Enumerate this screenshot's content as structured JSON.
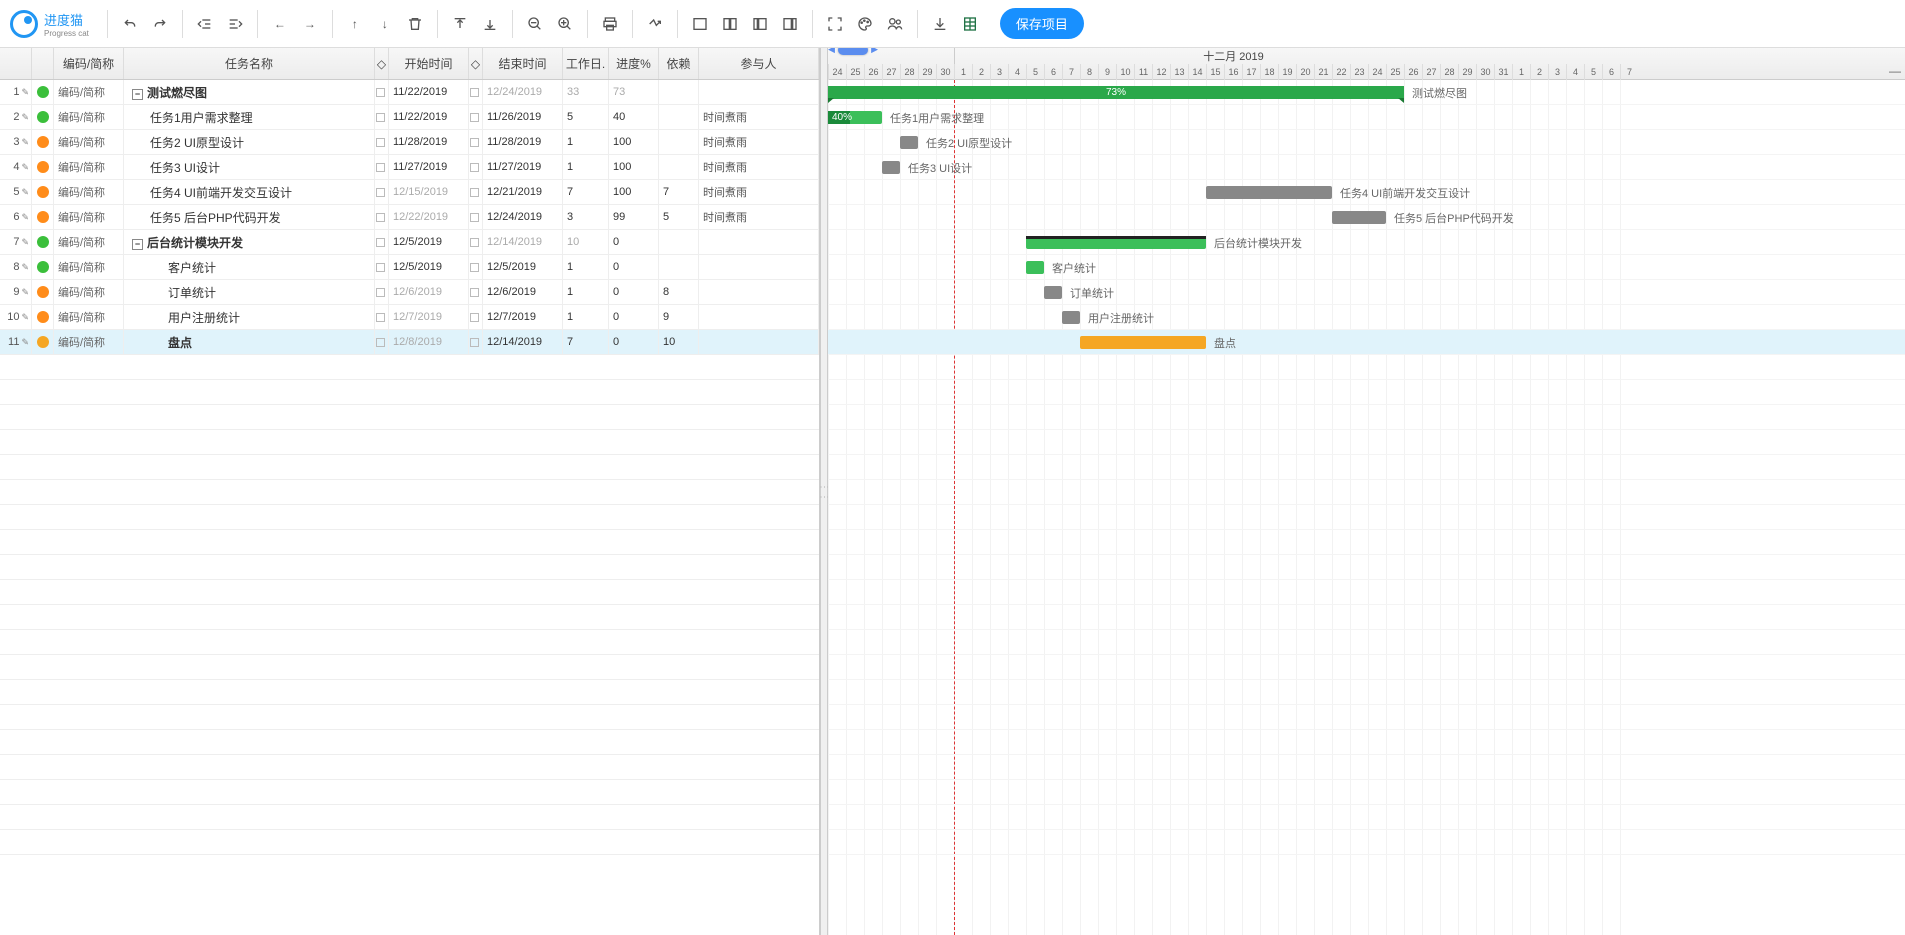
{
  "brand": {
    "name": "进度猫",
    "sub": "Progress cat"
  },
  "toolbar": {
    "save": "保存项目"
  },
  "columns": {
    "code": "编码/简称",
    "name": "任务名称",
    "start": "开始时间",
    "end": "结束时间",
    "days": "工作日.",
    "progress": "进度%",
    "dep": "依赖",
    "assign": "参与人"
  },
  "timeline": {
    "month": "十二月 2019",
    "days": [
      24,
      25,
      26,
      27,
      28,
      29,
      30,
      1,
      2,
      3,
      4,
      5,
      6,
      7,
      8,
      9,
      10,
      11,
      12,
      13,
      14,
      15,
      16,
      17,
      18,
      19,
      20,
      21,
      22,
      23,
      24,
      25,
      26,
      27,
      28,
      29,
      30,
      31,
      1,
      2,
      3,
      4,
      5,
      6,
      7
    ],
    "todayIndex": 7,
    "dayWidth": 18
  },
  "rows": [
    {
      "n": 1,
      "status": "green",
      "code": "编码/简称",
      "name": "测试燃尽图",
      "indent": 0,
      "group": true,
      "start": "11/22/2019",
      "end": "12/24/2019",
      "endDim": true,
      "days": "33",
      "daysDim": true,
      "prog": "73",
      "progDim": true,
      "dep": "",
      "assign": "",
      "barStart": 0,
      "barLen": 32,
      "barType": "group",
      "pct": "73%"
    },
    {
      "n": 2,
      "status": "green",
      "code": "编码/简称",
      "name": "任务1用户需求整理",
      "indent": 1,
      "start": "11/22/2019",
      "end": "11/26/2019",
      "days": "5",
      "prog": "40",
      "dep": "",
      "assign": "时间煮雨",
      "barStart": 0,
      "barLen": 3,
      "barType": "task",
      "pct": "40%",
      "progW": 40
    },
    {
      "n": 3,
      "status": "orange",
      "code": "编码/简称",
      "name": "任务2 UI原型设计",
      "indent": 1,
      "start": "11/28/2019",
      "end": "11/28/2019",
      "days": "1",
      "prog": "100",
      "dep": "",
      "assign": "时间煮雨",
      "barStart": 4,
      "barLen": 1,
      "barType": "done"
    },
    {
      "n": 4,
      "status": "orange",
      "code": "编码/简称",
      "name": "任务3 UI设计",
      "indent": 1,
      "start": "11/27/2019",
      "end": "11/27/2019",
      "days": "1",
      "prog": "100",
      "dep": "",
      "assign": "时间煮雨",
      "barStart": 3,
      "barLen": 1,
      "barType": "done"
    },
    {
      "n": 5,
      "status": "orange",
      "code": "编码/简称",
      "name": "任务4 UI前端开发交互设计",
      "indent": 1,
      "start": "12/15/2019",
      "startDim": true,
      "end": "12/21/2019",
      "days": "7",
      "prog": "100",
      "dep": "7",
      "assign": "时间煮雨",
      "barStart": 21,
      "barLen": 7,
      "barType": "grey"
    },
    {
      "n": 6,
      "status": "orange",
      "code": "编码/简称",
      "name": "任务5 后台PHP代码开发",
      "indent": 1,
      "start": "12/22/2019",
      "startDim": true,
      "end": "12/24/2019",
      "days": "3",
      "prog": "99",
      "dep": "5",
      "assign": "时间煮雨",
      "barStart": 28,
      "barLen": 3,
      "barType": "grey"
    },
    {
      "n": 7,
      "status": "green",
      "code": "编码/简称",
      "name": "后台统计模块开发",
      "indent": 0,
      "group": true,
      "start": "12/5/2019",
      "end": "12/14/2019",
      "endDim": true,
      "days": "10",
      "daysDim": true,
      "prog": "0",
      "dep": "",
      "assign": "",
      "barStart": 11,
      "barLen": 10,
      "barType": "group2"
    },
    {
      "n": 8,
      "status": "green",
      "code": "编码/简称",
      "name": "客户统计",
      "indent": 2,
      "start": "12/5/2019",
      "end": "12/5/2019",
      "days": "1",
      "prog": "0",
      "dep": "",
      "assign": "",
      "barStart": 11,
      "barLen": 1,
      "barType": "task"
    },
    {
      "n": 9,
      "status": "orange",
      "code": "编码/简称",
      "name": "订单统计",
      "indent": 2,
      "start": "12/6/2019",
      "startDim": true,
      "end": "12/6/2019",
      "days": "1",
      "prog": "0",
      "dep": "8",
      "assign": "",
      "barStart": 12,
      "barLen": 1,
      "barType": "grey"
    },
    {
      "n": 10,
      "status": "orange",
      "code": "编码/简称",
      "name": "用户注册统计",
      "indent": 2,
      "start": "12/7/2019",
      "startDim": true,
      "end": "12/7/2019",
      "days": "1",
      "prog": "0",
      "dep": "9",
      "assign": "",
      "barStart": 13,
      "barLen": 1,
      "barType": "grey"
    },
    {
      "n": 11,
      "status": "yellow",
      "code": "编码/简称",
      "name": "盘点",
      "indent": 2,
      "selected": true,
      "bold": true,
      "start": "12/8/2019",
      "startDim": true,
      "end": "12/14/2019",
      "days": "7",
      "prog": "0",
      "dep": "10",
      "assign": "",
      "barStart": 14,
      "barLen": 7,
      "barType": "yellow"
    }
  ]
}
